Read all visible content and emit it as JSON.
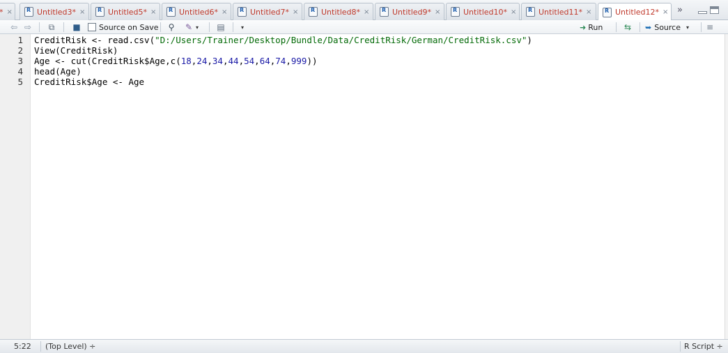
{
  "tabs": [
    {
      "label": "Untitled3*",
      "close": "×"
    },
    {
      "label": "Untitled5*",
      "close": "×"
    },
    {
      "label": "Untitled6*",
      "close": "×"
    },
    {
      "label": "Untitled7*",
      "close": "×"
    },
    {
      "label": "Untitled8*",
      "close": "×"
    },
    {
      "label": "Untitled9*",
      "close": "×"
    },
    {
      "label": "Untitled10*",
      "close": "×"
    },
    {
      "label": "Untitled11*",
      "close": "×"
    },
    {
      "label": "Untitled12*",
      "close": "×"
    }
  ],
  "partial_tab": {
    "label": "*",
    "close": "×"
  },
  "toolbar": {
    "source_on_save": "Source on Save",
    "run": "Run",
    "source": "Source"
  },
  "editor": {
    "lines": [
      {
        "num": "1",
        "segments": [
          {
            "t": "CreditRisk <- read.csv(",
            "c": ""
          },
          {
            "t": "\"D:/Users/Trainer/Desktop/Bundle/Data/CreditRisk/German/CreditRisk.csv\"",
            "c": "str"
          },
          {
            "t": ")",
            "c": ""
          }
        ]
      },
      {
        "num": "2",
        "segments": [
          {
            "t": "View(CreditRisk)",
            "c": ""
          }
        ]
      },
      {
        "num": "3",
        "segments": [
          {
            "t": "Age <- cut(CreditRisk$Age,c(",
            "c": ""
          },
          {
            "t": "18",
            "c": "numv"
          },
          {
            "t": ",",
            "c": ""
          },
          {
            "t": "24",
            "c": "numv"
          },
          {
            "t": ",",
            "c": ""
          },
          {
            "t": "34",
            "c": "numv"
          },
          {
            "t": ",",
            "c": ""
          },
          {
            "t": "44",
            "c": "numv"
          },
          {
            "t": ",",
            "c": ""
          },
          {
            "t": "54",
            "c": "numv"
          },
          {
            "t": ",",
            "c": ""
          },
          {
            "t": "64",
            "c": "numv"
          },
          {
            "t": ",",
            "c": ""
          },
          {
            "t": "74",
            "c": "numv"
          },
          {
            "t": ",",
            "c": ""
          },
          {
            "t": "999",
            "c": "numv"
          },
          {
            "t": "))",
            "c": ""
          }
        ]
      },
      {
        "num": "4",
        "segments": [
          {
            "t": "head(Age)",
            "c": ""
          }
        ]
      },
      {
        "num": "5",
        "segments": [
          {
            "t": "CreditRisk$Age <- Age",
            "c": ""
          }
        ]
      }
    ]
  },
  "status": {
    "position": "5:22",
    "scope": "(Top Level) ÷",
    "filetype": "R Script ÷"
  }
}
